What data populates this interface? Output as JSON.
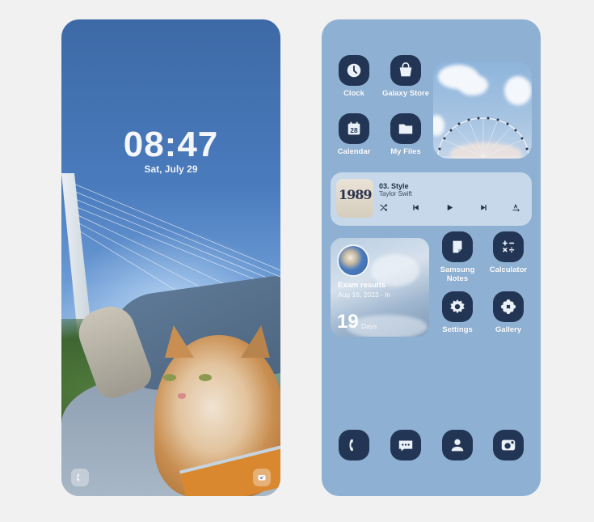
{
  "lock_screen": {
    "time": "08:47",
    "date": "Sat, July 29",
    "shortcuts": [
      {
        "name": "phone",
        "icon": "phone-icon"
      },
      {
        "name": "camera",
        "icon": "camera-icon"
      }
    ]
  },
  "home_screen": {
    "apps_top": [
      {
        "label": "Clock",
        "icon": "clock-icon"
      },
      {
        "label": "Galaxy Store",
        "icon": "shopping-bag-icon"
      },
      {
        "label": "Calendar",
        "icon": "calendar-icon",
        "badge": "28"
      },
      {
        "label": "My Files",
        "icon": "folder-icon"
      }
    ],
    "music_widget": {
      "track": "03. Style",
      "artist": "Taylor Swift",
      "album_art_text": "1989",
      "controls": [
        "shuffle",
        "previous",
        "play",
        "next",
        "cast"
      ]
    },
    "dday_widget": {
      "title": "Exam results",
      "subtitle": "Aug 16, 2023 - In",
      "count": "19",
      "unit": "Days"
    },
    "apps_mid": [
      {
        "label": "Samsung Notes",
        "icon": "notes-icon"
      },
      {
        "label": "Calculator",
        "icon": "calculator-icon"
      },
      {
        "label": "Settings",
        "icon": "gear-icon"
      },
      {
        "label": "Gallery",
        "icon": "flower-icon"
      }
    ],
    "dock": [
      {
        "label": "Phone",
        "icon": "phone-icon"
      },
      {
        "label": "Messages",
        "icon": "chat-bubble-icon"
      },
      {
        "label": "Contacts",
        "icon": "person-icon"
      },
      {
        "label": "Camera",
        "icon": "camera-icon"
      }
    ]
  },
  "colors": {
    "icon_bg": "#233554",
    "home_bg": "#8eb0d3",
    "lock_sky": "#3d6aa6"
  }
}
